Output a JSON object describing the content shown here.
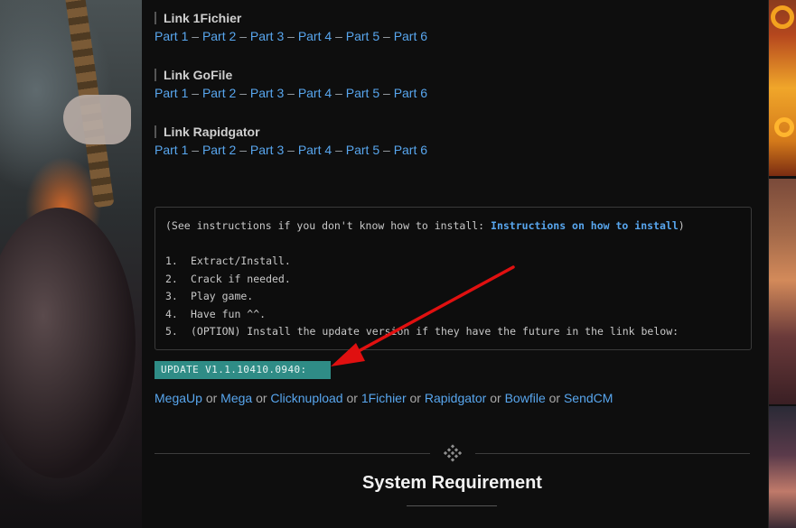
{
  "link_groups": [
    {
      "heading": "Link 1Fichier",
      "parts": [
        "Part 1",
        "Part 2",
        "Part 3",
        "Part 4",
        "Part 5",
        "Part 6"
      ]
    },
    {
      "heading": "Link GoFile",
      "parts": [
        "Part 1",
        "Part 2",
        "Part 3",
        "Part 4",
        "Part 5",
        "Part 6"
      ]
    },
    {
      "heading": "Link Rapidgator",
      "parts": [
        "Part 1",
        "Part 2",
        "Part 3",
        "Part 4",
        "Part 5",
        "Part 6"
      ]
    }
  ],
  "part_separator": "–",
  "instructions": {
    "intro_prefix": "(See instructions if you don't know how to install: ",
    "intro_link": "Instructions on how to install",
    "intro_suffix": ")",
    "steps": [
      {
        "num": "1.",
        "text": "Extract/Install."
      },
      {
        "num": "2.",
        "text": "Crack if needed."
      },
      {
        "num": "3.",
        "text": "Play game."
      },
      {
        "num": "4.",
        "text": "Have fun ^^."
      },
      {
        "num": "5.",
        "text": "(OPTION) Install the update version if they have the future in the link below:"
      }
    ]
  },
  "update": {
    "label": "UPDATE V1.1.10410.0940:",
    "mirrors": [
      "MegaUp",
      "Mega",
      "Clicknupload",
      "1Fichier",
      "Rapidgator",
      "Bowfile",
      "SendCM"
    ],
    "joiner": "or"
  },
  "section": {
    "title": "System Requirement"
  },
  "colors": {
    "link": "#58a6ee",
    "update_bg": "#2f8c86",
    "arrow": "#e01010"
  }
}
